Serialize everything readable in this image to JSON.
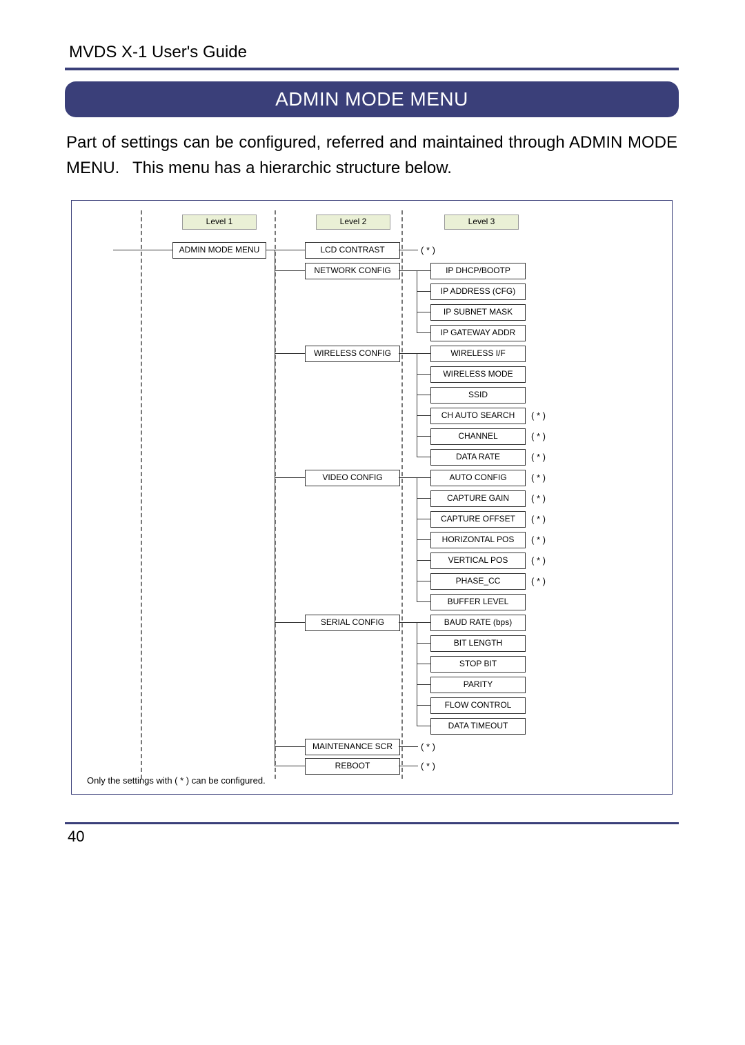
{
  "header": {
    "doc_title": "MVDS X-1 User's Guide"
  },
  "title": "ADMIN MODE MENU",
  "intro": "Part of settings can be configured, referred and maintained through ADMIN MODE MENU.  This menu has a hierarchic structure below.",
  "cols": {
    "l1": "Level 1",
    "l2": "Level 2",
    "l3": "Level 3"
  },
  "l1": {
    "root": "ADMIN MODE MENU"
  },
  "l2": {
    "lcd": "LCD CONTRAST",
    "net": "NETWORK CONFIG",
    "wl": "WIRELESS CONFIG",
    "vid": "VIDEO CONFIG",
    "ser": "SERIAL CONFIG",
    "maint": "MAINTENANCE SCR",
    "reboot": "REBOOT"
  },
  "l3": {
    "net": [
      "IP DHCP/BOOTP",
      "IP ADDRESS (CFG)",
      "IP SUBNET MASK",
      "IP GATEWAY ADDR"
    ],
    "wl": [
      "WIRELESS I/F",
      "WIRELESS MODE",
      "SSID",
      "CH AUTO SEARCH",
      "CHANNEL",
      "DATA RATE"
    ],
    "vid": [
      "AUTO CONFIG",
      "CAPTURE GAIN",
      "CAPTURE OFFSET",
      "HORIZONTAL POS",
      "VERTICAL POS",
      "PHASE_CC",
      "BUFFER LEVEL"
    ],
    "ser": [
      "BAUD RATE (bps)",
      "BIT LENGTH",
      "STOP BIT",
      "PARITY",
      "FLOW CONTROL",
      "DATA TIMEOUT"
    ]
  },
  "star": "( * )",
  "footnote": "Only the settings with ( * ) can be configured.",
  "page_number": "40",
  "chart_data": {
    "type": "tree",
    "title": "ADMIN MODE MENU hierarchy",
    "levels": [
      "Level 1",
      "Level 2",
      "Level 3"
    ],
    "note": "Only the settings with ( * ) can be configured.",
    "root": {
      "label": "ADMIN MODE MENU",
      "children": [
        {
          "label": "LCD CONTRAST",
          "configurable": true,
          "children": []
        },
        {
          "label": "NETWORK CONFIG",
          "configurable": false,
          "children": [
            {
              "label": "IP DHCP/BOOTP",
              "configurable": false
            },
            {
              "label": "IP ADDRESS (CFG)",
              "configurable": false
            },
            {
              "label": "IP SUBNET MASK",
              "configurable": false
            },
            {
              "label": "IP GATEWAY ADDR",
              "configurable": false
            }
          ]
        },
        {
          "label": "WIRELESS CONFIG",
          "configurable": false,
          "children": [
            {
              "label": "WIRELESS I/F",
              "configurable": false
            },
            {
              "label": "WIRELESS MODE",
              "configurable": false
            },
            {
              "label": "SSID",
              "configurable": false
            },
            {
              "label": "CH AUTO SEARCH",
              "configurable": true
            },
            {
              "label": "CHANNEL",
              "configurable": true
            },
            {
              "label": "DATA RATE",
              "configurable": true
            }
          ]
        },
        {
          "label": "VIDEO CONFIG",
          "configurable": false,
          "children": [
            {
              "label": "AUTO CONFIG",
              "configurable": true
            },
            {
              "label": "CAPTURE GAIN",
              "configurable": true
            },
            {
              "label": "CAPTURE OFFSET",
              "configurable": true
            },
            {
              "label": "HORIZONTAL POS",
              "configurable": true
            },
            {
              "label": "VERTICAL POS",
              "configurable": true
            },
            {
              "label": "PHASE_CC",
              "configurable": true
            },
            {
              "label": "BUFFER LEVEL",
              "configurable": false
            }
          ]
        },
        {
          "label": "SERIAL CONFIG",
          "configurable": false,
          "children": [
            {
              "label": "BAUD RATE (bps)",
              "configurable": false
            },
            {
              "label": "BIT LENGTH",
              "configurable": false
            },
            {
              "label": "STOP BIT",
              "configurable": false
            },
            {
              "label": "PARITY",
              "configurable": false
            },
            {
              "label": "FLOW CONTROL",
              "configurable": false
            },
            {
              "label": "DATA TIMEOUT",
              "configurable": false
            }
          ]
        },
        {
          "label": "MAINTENANCE SCR",
          "configurable": true,
          "children": []
        },
        {
          "label": "REBOOT",
          "configurable": true,
          "children": []
        }
      ]
    }
  }
}
